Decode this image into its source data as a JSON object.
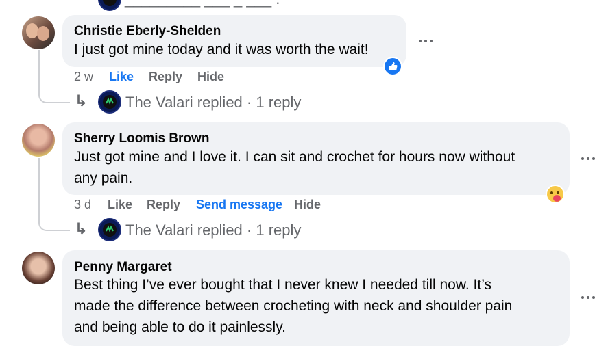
{
  "top_partial": {
    "text": "_________ ___ _ ___ ."
  },
  "comments": [
    {
      "author": "Christie Eberly-Shelden",
      "text_lines": [
        "I just got mine today and it was worth the wait!"
      ],
      "time": "2 w",
      "actions": {
        "like": "Like",
        "reply": "Reply",
        "hide": "Hide"
      },
      "reaction": "like-reaction-icon",
      "reply_summary": {
        "page_name": "The Valari replied",
        "separator": " · ",
        "count": "1 reply"
      }
    },
    {
      "author": "Sherry Loomis Brown",
      "text_lines": [
        "Just got mine and I love it. I can sit and crochet for hours now without",
        "any pain."
      ],
      "time": "3 d",
      "actions": {
        "like": "Like",
        "reply": "Reply",
        "send_message": "Send message",
        "hide": "Hide"
      },
      "reaction": "care-reaction-icon",
      "reply_summary": {
        "page_name": "The Valari replied",
        "separator": " · ",
        "count": "1 reply"
      }
    },
    {
      "author": "Penny Margaret",
      "text_lines": [
        "Best thing I’ve ever bought that I never knew I needed till now. It’s",
        "made the difference between crocheting with neck and shoulder pain",
        "and being able to do it painlessly."
      ]
    }
  ],
  "colors": {
    "bubble": "#f0f2f5",
    "link_blue": "#1877f2",
    "secondary_text": "#65676b",
    "thread_line": "#ced0d4"
  }
}
